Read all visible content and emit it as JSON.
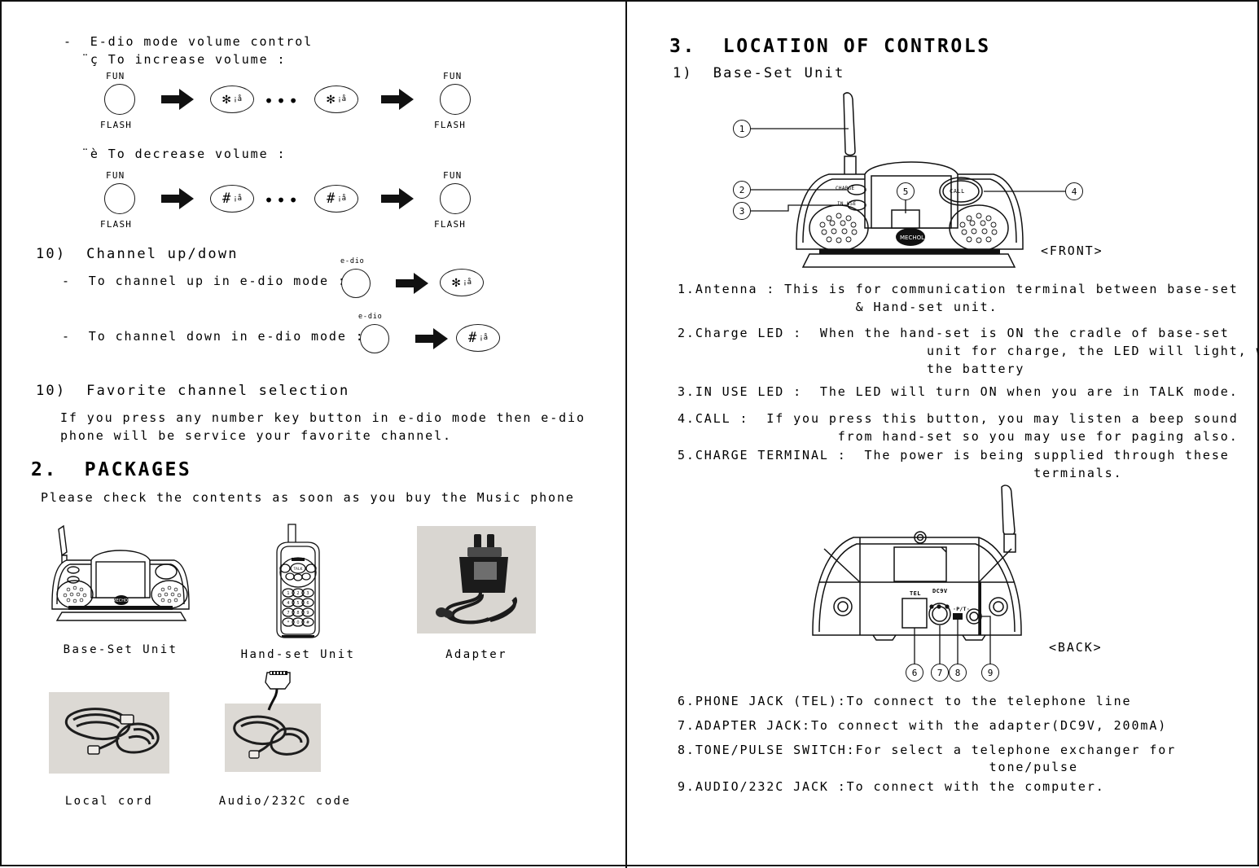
{
  "left": {
    "volume_section": {
      "heading": "-  E-dio mode volume control",
      "increase_label": "¨ç To increase volume :",
      "decrease_label": "¨è To decrease volume :",
      "fun_label": "FUN",
      "flash_label": "FLASH",
      "star_symbol": "✻",
      "hash_symbol": "#",
      "key_sub": "¡å",
      "ellipsis": "•••"
    },
    "channel_section": {
      "heading": "10)  Channel up/down",
      "up_text": "-  To channel up in e-dio mode :",
      "down_text": "-  To channel down in e-dio mode :",
      "edio_label": "e-dio",
      "star_symbol": "✻",
      "hash_symbol": "#",
      "key_sub": "¡å"
    },
    "favorite_section": {
      "heading": "10)  Favorite channel selection",
      "body_line1": "If you press any number key button in e-dio mode then e-dio",
      "body_line2": "phone will be service your favorite channel."
    },
    "packages_section": {
      "heading": "2.  PACKAGES",
      "intro": "Please check the contents as soon as you buy the Music phone",
      "items": [
        {
          "caption": "Base-Set Unit"
        },
        {
          "caption": "Hand-set Unit"
        },
        {
          "caption": "Adapter"
        },
        {
          "caption": "Local cord"
        },
        {
          "caption": "Audio/232C code"
        }
      ]
    }
  },
  "right": {
    "heading": "3.  LOCATION OF CONTROLS",
    "subheading": "1)  Base-Set Unit",
    "front_view_label": "<FRONT>",
    "back_view_label": "<BACK>",
    "front_diagram": {
      "callouts": [
        "1",
        "2",
        "3",
        "4",
        "5"
      ],
      "charge_led_label": "CHARGE",
      "in_use_led_label": "IN USE",
      "call_button_label": "CALL",
      "brand_label": "MECHOL"
    },
    "back_diagram": {
      "callouts": [
        "6",
        "7",
        "8",
        "9"
      ],
      "tel_label": "TEL",
      "dc_label": "DC9V",
      "pt_label": "·P/T·"
    },
    "front_list": [
      {
        "num": "1.",
        "lines": [
          "Antenna : This is for communication terminal between base-set",
          "                    & Hand-set unit."
        ]
      },
      {
        "num": "2.",
        "lines": [
          "Charge LED :  When the hand-set is ON the cradle of base-set",
          "                            unit for charge, the LED will light, when charge",
          "                            the battery"
        ]
      },
      {
        "num": "3.",
        "lines": [
          "IN USE LED :  The LED will turn ON when you are in TALK mode."
        ]
      },
      {
        "num": "4.",
        "lines": [
          "CALL :  If you press this button, you may listen a beep sound",
          "                  from hand-set so you may use for paging also."
        ]
      },
      {
        "num": "5.",
        "lines": [
          "CHARGE TERMINAL :  The power is being supplied through these",
          "                                        terminals."
        ]
      }
    ],
    "back_list": [
      {
        "num": "6.",
        "lines": [
          "PHONE JACK (TEL):To connect to the telephone line"
        ]
      },
      {
        "num": "7.",
        "lines": [
          "ADAPTER JACK:To connect with the adapter(DC9V, 200mA)"
        ]
      },
      {
        "num": "8.",
        "lines": [
          "TONE/PULSE SWITCH:For select a telephone exchanger for",
          "                                   tone/pulse"
        ]
      },
      {
        "num": "9.",
        "lines": [
          "AUDIO/232C JACK :To connect with the computer."
        ]
      }
    ]
  }
}
